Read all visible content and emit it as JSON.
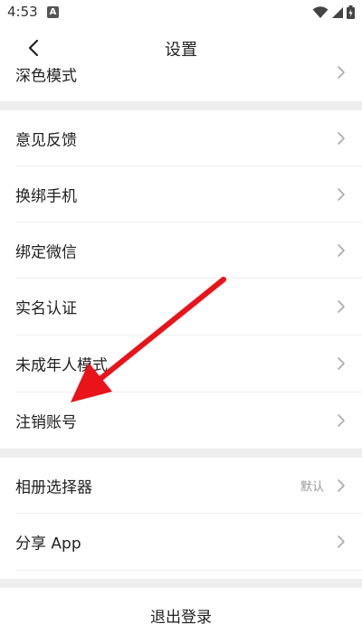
{
  "status_bar": {
    "time": "4:53",
    "notification_badge": "A",
    "icons": [
      "wifi-icon",
      "signal-icon",
      "battery-icon"
    ]
  },
  "header": {
    "title": "设置"
  },
  "menu": {
    "dark_mode": "深色模式",
    "feedback": "意见反馈",
    "change_phone": "换绑手机",
    "bind_wechat": "绑定微信",
    "real_name": "实名认证",
    "minor_mode": "未成年人模式",
    "cancel_account": "注销账号",
    "album_picker": "相册选择器",
    "album_picker_value": "默认",
    "share_app": "分享 App"
  },
  "footer": {
    "logout": "退出登录"
  },
  "colors": {
    "annotation_arrow": "#e8141a",
    "section_gap": "#eeeeee",
    "secondary_text": "#999999"
  }
}
